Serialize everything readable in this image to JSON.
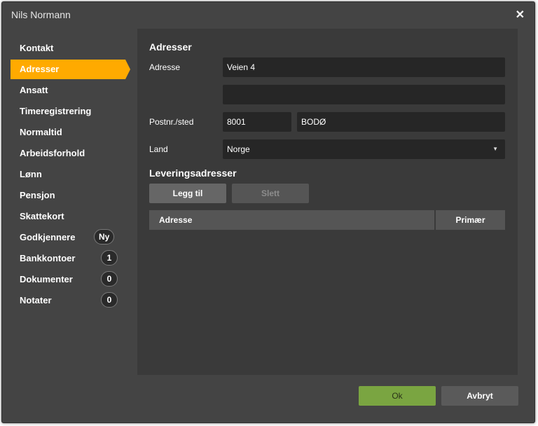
{
  "window": {
    "title": "Nils Normann",
    "close_symbol": "✕"
  },
  "sidebar": {
    "items": [
      {
        "label": "Kontakt"
      },
      {
        "label": "Adresser",
        "active": true
      },
      {
        "label": "Ansatt"
      },
      {
        "label": "Timeregistrering"
      },
      {
        "label": "Normaltid"
      },
      {
        "label": "Arbeidsforhold"
      },
      {
        "label": "Lønn"
      },
      {
        "label": "Pensjon"
      },
      {
        "label": "Skattekort"
      },
      {
        "label": "Godkjennere",
        "badge": "Ny"
      },
      {
        "label": "Bankkontoer",
        "badge": "1"
      },
      {
        "label": "Dokumenter",
        "badge": "0"
      },
      {
        "label": "Notater",
        "badge": "0"
      }
    ]
  },
  "form": {
    "section_title": "Adresser",
    "address_label": "Adresse",
    "address_line1": "Veien 4",
    "address_line2": "",
    "postal_label": "Postnr./sted",
    "postal_code": "8001",
    "city": "BODØ",
    "country_label": "Land",
    "country": "Norge"
  },
  "delivery": {
    "section_title": "Leveringsadresser",
    "add_button": "Legg til",
    "delete_button": "Slett",
    "columns": [
      "Adresse",
      "Primær"
    ]
  },
  "footer": {
    "ok_label": "Ok",
    "cancel_label": "Avbryt"
  },
  "colors": {
    "accent": "#ffaa00",
    "ok": "#7aa541",
    "background": "#444444",
    "panel": "#3a3a3a"
  }
}
